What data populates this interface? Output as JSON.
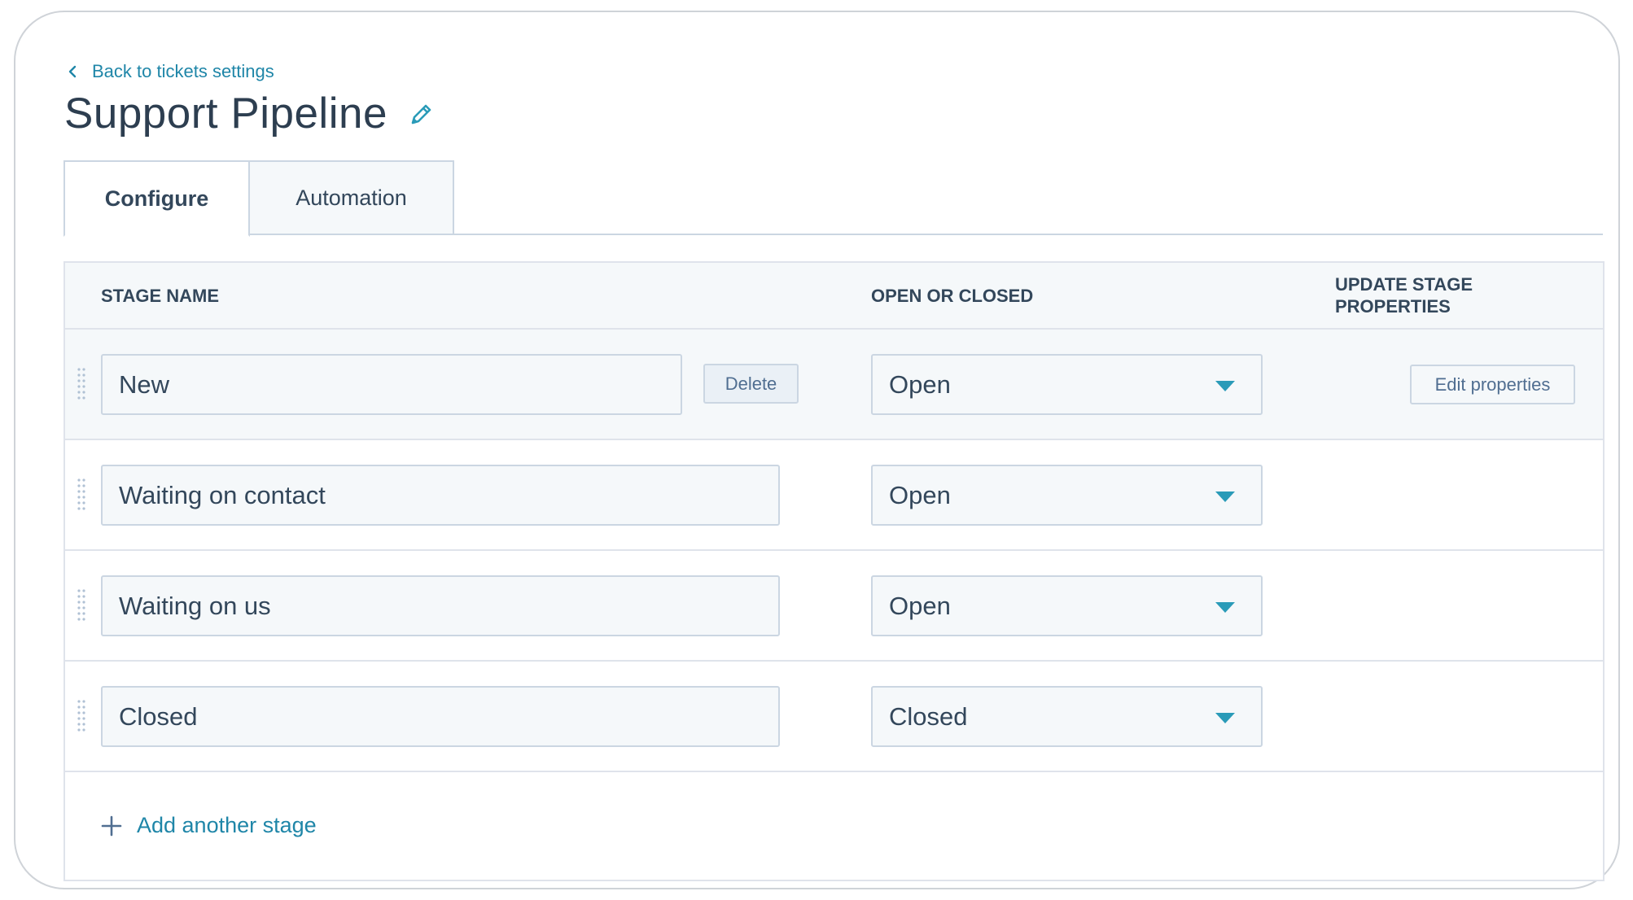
{
  "header": {
    "back_link": "Back to tickets settings",
    "title": "Support Pipeline"
  },
  "tabs": [
    {
      "label": "Configure",
      "active": true
    },
    {
      "label": "Automation",
      "active": false
    }
  ],
  "table": {
    "columns": {
      "stage_name": "STAGE NAME",
      "open_or_closed": "OPEN OR CLOSED",
      "update_stage_properties": "UPDATE STAGE PROPERTIES"
    },
    "rows": [
      {
        "stage_name": "New",
        "status": "Open",
        "delete_label": "Delete",
        "edit_label": "Edit properties"
      },
      {
        "stage_name": "Waiting on contact",
        "status": "Open"
      },
      {
        "stage_name": "Waiting on us",
        "status": "Open"
      },
      {
        "stage_name": "Closed",
        "status": "Closed"
      }
    ],
    "add_stage_label": "Add another stage"
  },
  "colors": {
    "link": "#1f86a8",
    "text": "#33475b",
    "border": "#cbd6e2",
    "caret": "#2a9bb8",
    "row_highlight": "#f5f8fa"
  }
}
